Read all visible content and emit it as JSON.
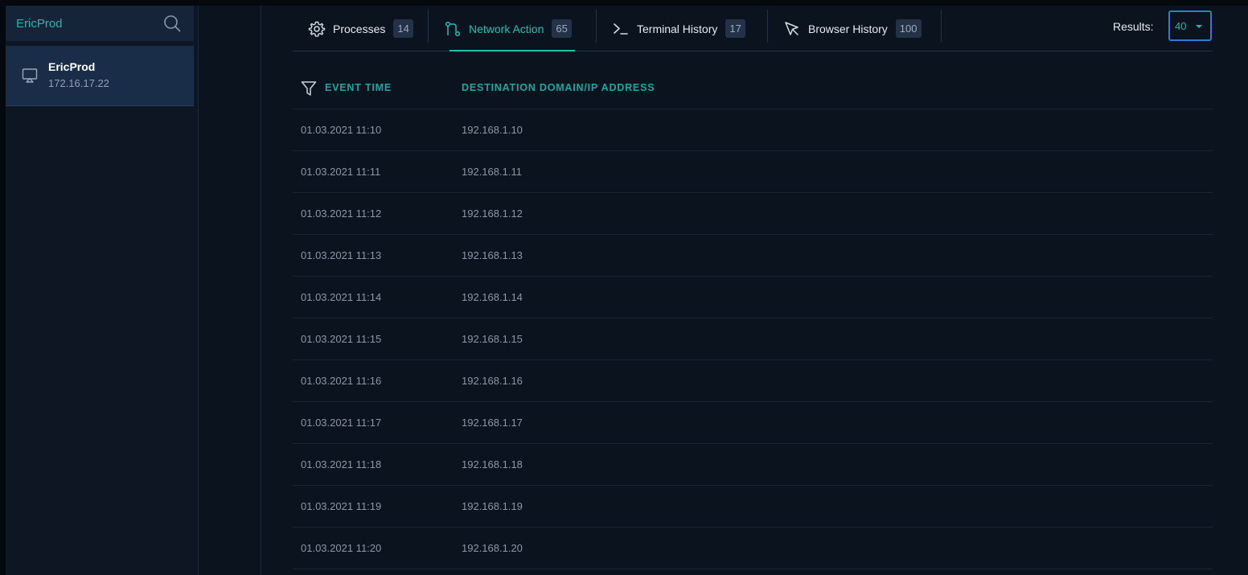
{
  "sidebar": {
    "search": {
      "value": "EricProd",
      "placeholder": ""
    },
    "host": {
      "name": "EricProd",
      "ip": "172.16.17.22"
    }
  },
  "tabs": [
    {
      "label": "Processes",
      "count": "14",
      "icon": "gear-icon"
    },
    {
      "label": "Network Action",
      "count": "65",
      "icon": "network-icon",
      "active": true
    },
    {
      "label": "Terminal History",
      "count": "17",
      "icon": "terminal-icon"
    },
    {
      "label": "Browser History",
      "count": "100",
      "icon": "cursor-icon"
    }
  ],
  "results": {
    "label": "Results:",
    "value": "40"
  },
  "table": {
    "headers": {
      "time": "EVENT TIME",
      "dest": "DESTINATION DOMAIN/IP ADDRESS"
    },
    "rows": [
      {
        "time": "01.03.2021 11:10",
        "dest": "192.168.1.10"
      },
      {
        "time": "01.03.2021 11:11",
        "dest": "192.168.1.11"
      },
      {
        "time": "01.03.2021 11:12",
        "dest": "192.168.1.12"
      },
      {
        "time": "01.03.2021 11:13",
        "dest": "192.168.1.13"
      },
      {
        "time": "01.03.2021 11:14",
        "dest": "192.168.1.14"
      },
      {
        "time": "01.03.2021 11:15",
        "dest": "192.168.1.15"
      },
      {
        "time": "01.03.2021 11:16",
        "dest": "192.168.1.16"
      },
      {
        "time": "01.03.2021 11:17",
        "dest": "192.168.1.17"
      },
      {
        "time": "01.03.2021 11:18",
        "dest": "192.168.1.18"
      },
      {
        "time": "01.03.2021 11:19",
        "dest": "192.168.1.19"
      },
      {
        "time": "01.03.2021 11:20",
        "dest": "192.168.1.20"
      }
    ]
  },
  "colors": {
    "accent": "#1fc0b5",
    "background": "#0b131e",
    "select_border": "#2d7bd8"
  }
}
